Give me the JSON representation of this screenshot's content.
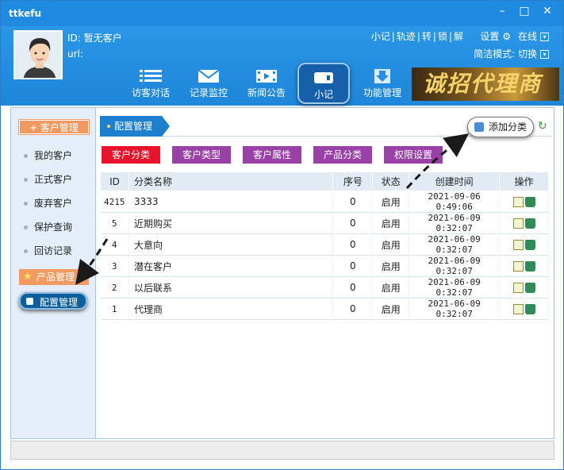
{
  "app": {
    "title": "ttkefu"
  },
  "profile": {
    "id_label": "ID:",
    "id_value": "暂无客户",
    "url_label": "url:"
  },
  "toplinks": [
    "小记",
    "轨迹",
    "转",
    "锁",
    "解"
  ],
  "settings": {
    "label": "设置",
    "status": "在线",
    "mode_label": "简洁模式: 切换"
  },
  "nav": [
    {
      "label": "访客对话",
      "icon": "list-icon"
    },
    {
      "label": "记录监控",
      "icon": "mail-icon"
    },
    {
      "label": "新闻公告",
      "icon": "video-icon"
    },
    {
      "label": "小记",
      "icon": "note-icon",
      "active": true
    },
    {
      "label": "功能管理",
      "icon": "download-icon"
    }
  ],
  "banner": {
    "text": "诚招代理商"
  },
  "sidebar": {
    "header": "+ 客户管理",
    "items": [
      "我的客户",
      "正式客户",
      "废弃客户",
      "保护查询",
      "回访记录"
    ],
    "product": "产品管理",
    "config": "配置管理"
  },
  "main": {
    "tab": "配置管理",
    "add_button": "添加分类",
    "buttons": [
      {
        "label": "客户分类",
        "color": "#e8132a"
      },
      {
        "label": "客户类型",
        "color": "#9a41a8"
      },
      {
        "label": "客户属性",
        "color": "#9a41a8"
      },
      {
        "label": "产品分类",
        "color": "#9a41a8"
      },
      {
        "label": "权限设置",
        "color": "#9a41a8"
      }
    ],
    "columns": [
      "ID",
      "分类名称",
      "序号",
      "状态",
      "创建时间",
      "操作"
    ],
    "rows": [
      {
        "id": "4215",
        "name": "3333",
        "order": "0",
        "status": "启用",
        "created": "2021-09-06 0:49:06"
      },
      {
        "id": "5",
        "name": "近期购买",
        "order": "0",
        "status": "启用",
        "created": "2021-06-09 0:32:07"
      },
      {
        "id": "4",
        "name": "大意向",
        "order": "0",
        "status": "启用",
        "created": "2021-06-09 0:32:07"
      },
      {
        "id": "3",
        "name": "潜在客户",
        "order": "0",
        "status": "启用",
        "created": "2021-06-09 0:32:07"
      },
      {
        "id": "2",
        "name": "以后联系",
        "order": "0",
        "status": "启用",
        "created": "2021-06-09 0:32:07"
      },
      {
        "id": "1",
        "name": "代理商",
        "order": "0",
        "status": "启用",
        "created": "2021-06-09 0:32:07"
      }
    ]
  }
}
